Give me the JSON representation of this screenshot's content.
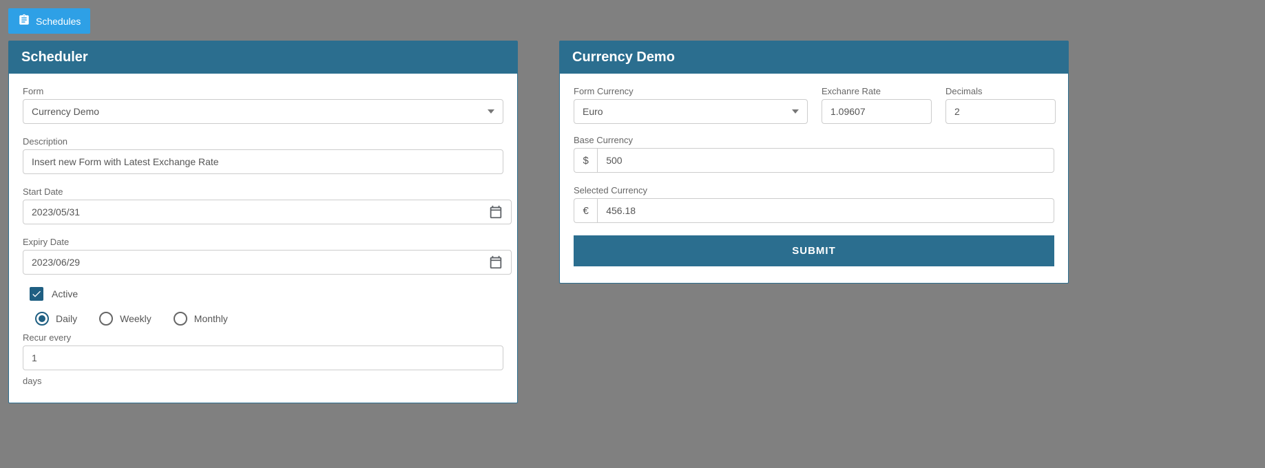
{
  "topbar": {
    "schedules_label": "Schedules"
  },
  "scheduler": {
    "title": "Scheduler",
    "form_label": "Form",
    "form_value": "Currency Demo",
    "description_label": "Description",
    "description_value": "Insert new Form with Latest Exchange Rate",
    "start_date_label": "Start Date",
    "start_date_value": "2023/05/31",
    "expiry_date_label": "Expiry Date",
    "expiry_date_value": "2023/06/29",
    "active_label": "Active",
    "active_checked": true,
    "frequency": {
      "daily": "Daily",
      "weekly": "Weekly",
      "monthly": "Monthly",
      "selected": "daily"
    },
    "recur_label": "Recur every",
    "recur_value": "1",
    "recur_unit": "days"
  },
  "currency": {
    "title": "Currency Demo",
    "form_currency_label": "Form Currency",
    "form_currency_value": "Euro",
    "exchange_rate_label": "Exchanre Rate",
    "exchange_rate_value": "1.09607",
    "decimals_label": "Decimals",
    "decimals_value": "2",
    "base_currency_label": "Base Currency",
    "base_currency_symbol": "$",
    "base_currency_value": "500",
    "selected_currency_label": "Selected Currency",
    "selected_currency_symbol": "€",
    "selected_currency_value": "456.18",
    "submit_label": "SUBMIT"
  }
}
